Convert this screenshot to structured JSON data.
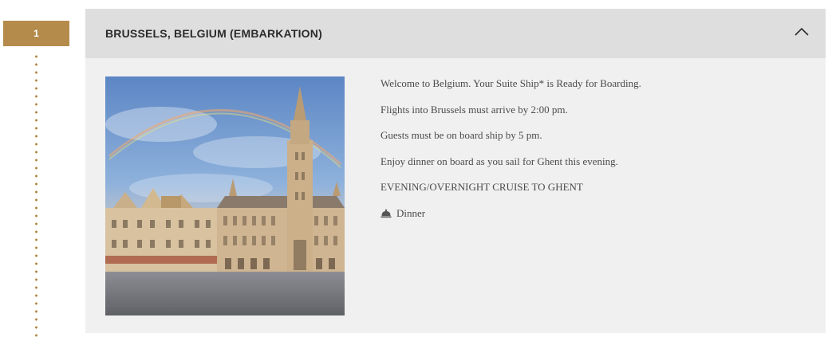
{
  "day": {
    "number": "1"
  },
  "stop": {
    "title": "BRUSSELS, BELGIUM (EMBARKATION)",
    "expanded": true,
    "image_icon": "grand-place-photo"
  },
  "details": {
    "lines": [
      "Welcome to Belgium. Your Suite Ship* is Ready for Boarding.",
      "Flights into Brussels must arrive by 2:00 pm.",
      "Guests must be on board ship by 5 pm.",
      "Enjoy dinner on board as you sail for Ghent this evening.",
      "EVENING/OVERNIGHT CRUISE TO GHENT"
    ],
    "meal_icon": "cloche-icon",
    "meal_label": "Dinner"
  },
  "colors": {
    "accent": "#b58b4c",
    "header_bg": "#dedede",
    "card_bg": "#f0f0f0",
    "text": "#4a4a4a"
  }
}
